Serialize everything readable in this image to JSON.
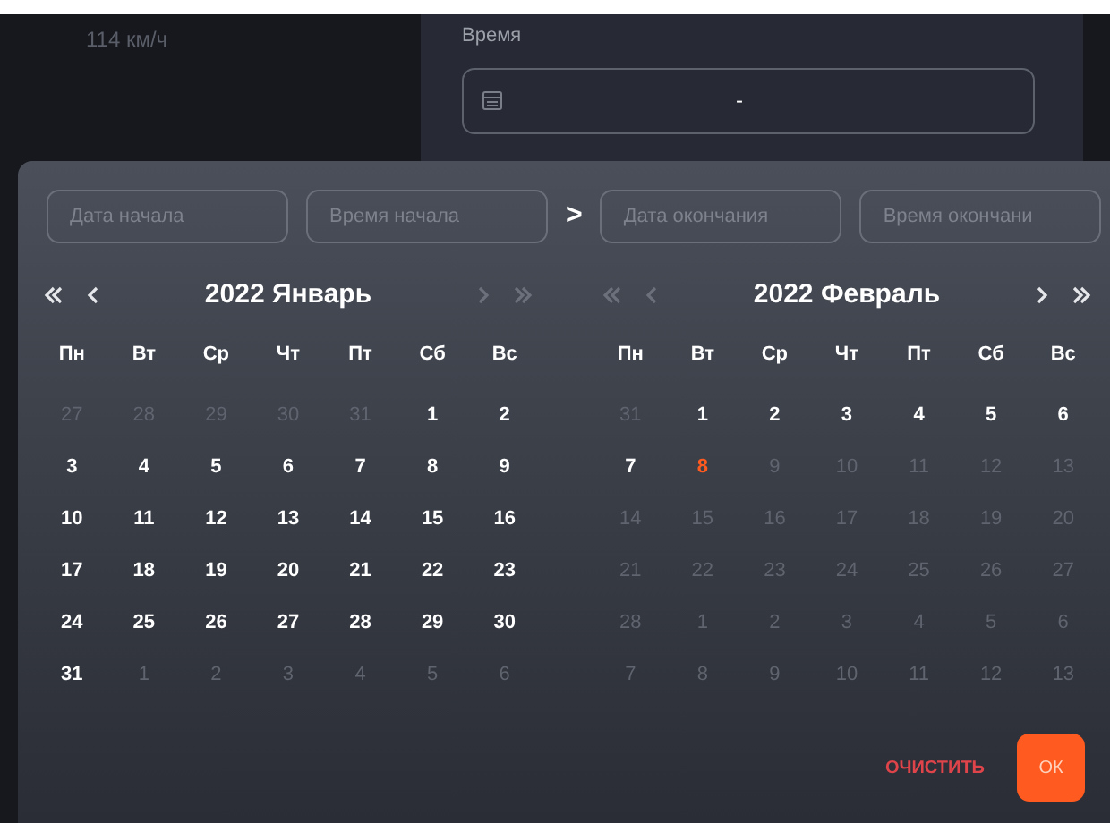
{
  "speed": "114 км/ч",
  "time_field": {
    "label": "Время",
    "value": "-"
  },
  "range_inputs": [
    {
      "placeholder": "Дата начала"
    },
    {
      "placeholder": "Время начала"
    },
    {
      "placeholder": "Дата окончания"
    },
    {
      "placeholder": "Время окончани"
    }
  ],
  "range_separator": ">",
  "months": [
    {
      "title": "2022 Январь",
      "prev_disabled": false,
      "next_disabled": true,
      "weekdays": [
        "Пн",
        "Вт",
        "Ср",
        "Чт",
        "Пт",
        "Сб",
        "Вс"
      ],
      "days": [
        {
          "label": "27",
          "kind": "other"
        },
        {
          "label": "28",
          "kind": "other"
        },
        {
          "label": "29",
          "kind": "other"
        },
        {
          "label": "30",
          "kind": "other"
        },
        {
          "label": "31",
          "kind": "other"
        },
        {
          "label": "1",
          "kind": "current"
        },
        {
          "label": "2",
          "kind": "current"
        },
        {
          "label": "3",
          "kind": "current"
        },
        {
          "label": "4",
          "kind": "current"
        },
        {
          "label": "5",
          "kind": "current"
        },
        {
          "label": "6",
          "kind": "current"
        },
        {
          "label": "7",
          "kind": "current"
        },
        {
          "label": "8",
          "kind": "current"
        },
        {
          "label": "9",
          "kind": "current"
        },
        {
          "label": "10",
          "kind": "current"
        },
        {
          "label": "11",
          "kind": "current"
        },
        {
          "label": "12",
          "kind": "current"
        },
        {
          "label": "13",
          "kind": "current"
        },
        {
          "label": "14",
          "kind": "current"
        },
        {
          "label": "15",
          "kind": "current"
        },
        {
          "label": "16",
          "kind": "current"
        },
        {
          "label": "17",
          "kind": "current"
        },
        {
          "label": "18",
          "kind": "current"
        },
        {
          "label": "19",
          "kind": "current"
        },
        {
          "label": "20",
          "kind": "current"
        },
        {
          "label": "21",
          "kind": "current"
        },
        {
          "label": "22",
          "kind": "current"
        },
        {
          "label": "23",
          "kind": "current"
        },
        {
          "label": "24",
          "kind": "current"
        },
        {
          "label": "25",
          "kind": "current"
        },
        {
          "label": "26",
          "kind": "current"
        },
        {
          "label": "27",
          "kind": "current"
        },
        {
          "label": "28",
          "kind": "current"
        },
        {
          "label": "29",
          "kind": "current"
        },
        {
          "label": "30",
          "kind": "current"
        },
        {
          "label": "31",
          "kind": "current"
        },
        {
          "label": "1",
          "kind": "other"
        },
        {
          "label": "2",
          "kind": "other"
        },
        {
          "label": "3",
          "kind": "other"
        },
        {
          "label": "4",
          "kind": "other"
        },
        {
          "label": "5",
          "kind": "other"
        },
        {
          "label": "6",
          "kind": "other"
        }
      ]
    },
    {
      "title": "2022 Февраль",
      "prev_disabled": true,
      "next_disabled": false,
      "weekdays": [
        "Пн",
        "Вт",
        "Ср",
        "Чт",
        "Пт",
        "Сб",
        "Вс"
      ],
      "days": [
        {
          "label": "31",
          "kind": "other"
        },
        {
          "label": "1",
          "kind": "current"
        },
        {
          "label": "2",
          "kind": "current"
        },
        {
          "label": "3",
          "kind": "current"
        },
        {
          "label": "4",
          "kind": "current"
        },
        {
          "label": "5",
          "kind": "current"
        },
        {
          "label": "6",
          "kind": "current"
        },
        {
          "label": "7",
          "kind": "current"
        },
        {
          "label": "8",
          "kind": "today"
        },
        {
          "label": "9",
          "kind": "disabled"
        },
        {
          "label": "10",
          "kind": "disabled"
        },
        {
          "label": "11",
          "kind": "disabled"
        },
        {
          "label": "12",
          "kind": "disabled"
        },
        {
          "label": "13",
          "kind": "disabled"
        },
        {
          "label": "14",
          "kind": "disabled"
        },
        {
          "label": "15",
          "kind": "disabled"
        },
        {
          "label": "16",
          "kind": "disabled"
        },
        {
          "label": "17",
          "kind": "disabled"
        },
        {
          "label": "18",
          "kind": "disabled"
        },
        {
          "label": "19",
          "kind": "disabled"
        },
        {
          "label": "20",
          "kind": "disabled"
        },
        {
          "label": "21",
          "kind": "disabled"
        },
        {
          "label": "22",
          "kind": "disabled"
        },
        {
          "label": "23",
          "kind": "disabled"
        },
        {
          "label": "24",
          "kind": "disabled"
        },
        {
          "label": "25",
          "kind": "disabled"
        },
        {
          "label": "26",
          "kind": "disabled"
        },
        {
          "label": "27",
          "kind": "disabled"
        },
        {
          "label": "28",
          "kind": "disabled"
        },
        {
          "label": "1",
          "kind": "other"
        },
        {
          "label": "2",
          "kind": "other"
        },
        {
          "label": "3",
          "kind": "other"
        },
        {
          "label": "4",
          "kind": "other"
        },
        {
          "label": "5",
          "kind": "other"
        },
        {
          "label": "6",
          "kind": "other"
        },
        {
          "label": "7",
          "kind": "other"
        },
        {
          "label": "8",
          "kind": "other"
        },
        {
          "label": "9",
          "kind": "other"
        },
        {
          "label": "10",
          "kind": "other"
        },
        {
          "label": "11",
          "kind": "other"
        },
        {
          "label": "12",
          "kind": "other"
        },
        {
          "label": "13",
          "kind": "other"
        }
      ]
    }
  ],
  "clear_button": "ОЧИСТИТЬ",
  "ok_button": {
    "label": "ОК",
    "disabled": true
  }
}
